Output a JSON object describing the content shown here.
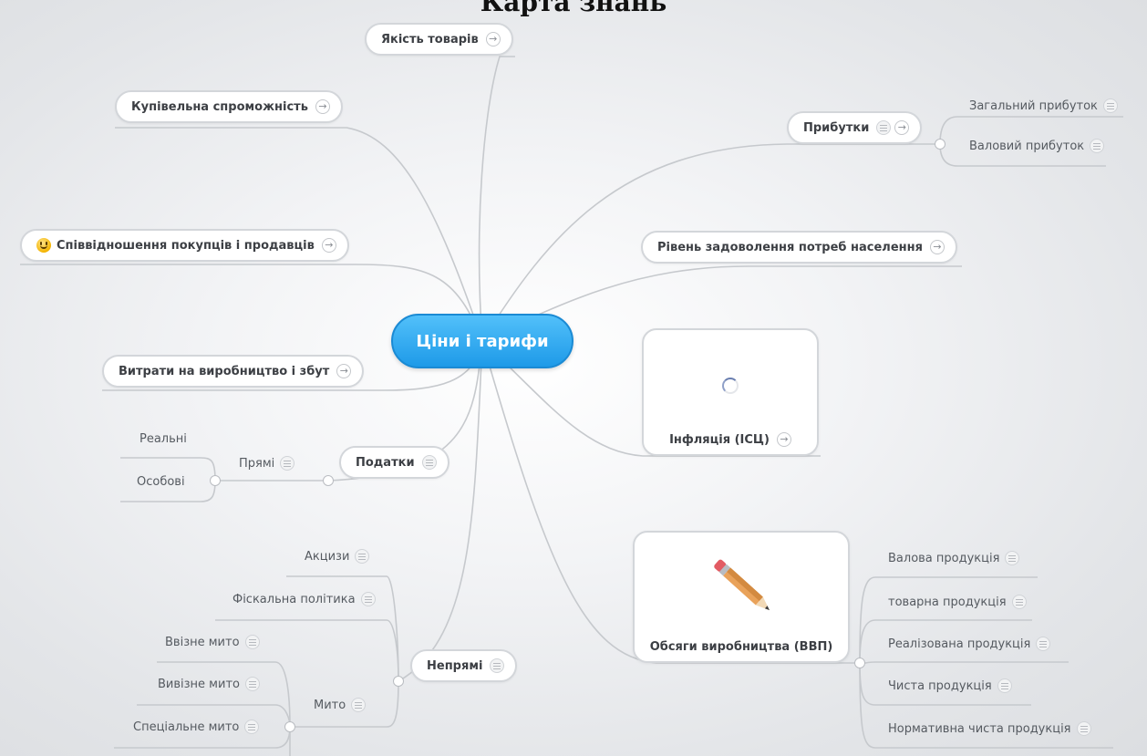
{
  "title": "Карта знань",
  "center": "Ціни і тарифи",
  "nodes": {
    "yakist": "Якість товарів",
    "kupivelna": "Купівельна спроможність",
    "spivvidnoshennia": "Співвідношення покупців і продавців",
    "vytraty": "Витрати на виробництво і збут",
    "podatky": "Податки",
    "nepriami": "Непрямі",
    "prybutky": "Прибутки",
    "riven": "Рівень задоволення потреб населення",
    "infliatsiia": "Інфляція (ІСЦ)",
    "obsiagy": "Обсяги виробництва (ВВП)"
  },
  "leaves": {
    "zahalnyi": "Загальний прибуток",
    "valovyi": "Валовий прибуток",
    "priami": "Прямі",
    "realni": "Реальні",
    "osobovi": "Особові",
    "aktsyzy": "Акцизи",
    "fiskalna": "Фіскальна політика",
    "myto": "Мито",
    "vvizne": "Ввізне мито",
    "vyvizne": "Вивізне мито",
    "spetsialne": "Спеціальне мито",
    "valova_prod": "Валова продукція",
    "tovarna_prod": "товарна продукція",
    "realizovana_prod": "Реалізована продукція",
    "chysta_prod": "Чиста продукція",
    "normatyvna_prod": "Нормативна чиста продукція"
  },
  "colors": {
    "center_top": "#52c0fa",
    "center_bottom": "#1e9ae8",
    "connector": "#c6c9cd",
    "node_border": "#d3d6da",
    "text": "#3c3f44"
  },
  "icons": {
    "follow_link": "arrow-icon",
    "note": "note-icon",
    "emoji": "smiley-icon",
    "loading": "spinner-icon",
    "image": "pencil-icon"
  }
}
